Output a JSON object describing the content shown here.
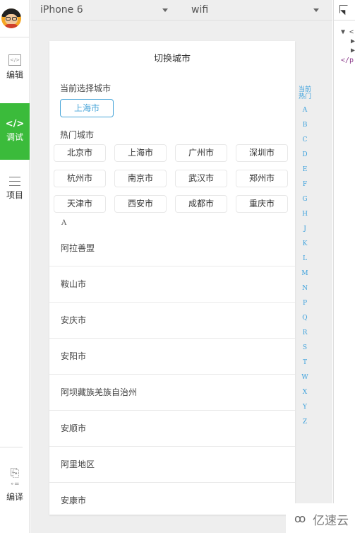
{
  "sidebar": {
    "items": [
      {
        "label": "编辑",
        "icon": "code-editor-icon",
        "icon_text": "</>"
      },
      {
        "label": "调试",
        "icon": "debug-icon",
        "icon_text": "</>",
        "active": true
      },
      {
        "label": "项目",
        "icon": "menu-lines-icon"
      },
      {
        "label": "编译",
        "icon": "compile-icon",
        "icon_text": "⎘",
        "sub_text": "∘="
      }
    ],
    "accent_color": "#3bbb3b"
  },
  "toolbar": {
    "device": "iPhone 6",
    "network": "wifi"
  },
  "phone": {
    "title": "切换城市",
    "current_label": "当前选择城市",
    "current_city": "上海市",
    "hot_label": "热门城市",
    "hot_cities": [
      "北京市",
      "上海市",
      "广州市",
      "深圳市",
      "杭州市",
      "南京市",
      "武汉市",
      "郑州市",
      "天津市",
      "西安市",
      "成都市",
      "重庆市"
    ],
    "group_letter": "A",
    "cities": [
      "阿拉善盟",
      "鞍山市",
      "安庆市",
      "安阳市",
      "阿坝藏族羌族自治州",
      "安顺市",
      "阿里地区",
      "安康市"
    ],
    "index_head": [
      "当前",
      "热门"
    ],
    "index_letters": [
      "A",
      "B",
      "C",
      "D",
      "E",
      "F",
      "G",
      "H",
      "J",
      "K",
      "L",
      "M",
      "N",
      "P",
      "Q",
      "R",
      "S",
      "T",
      "W",
      "X",
      "Y",
      "Z"
    ],
    "link_color": "#3aa0dc"
  },
  "devtools": {
    "lines": [
      "▼ <",
      "▶",
      "▶",
      "</p"
    ]
  },
  "watermark": {
    "logo": "ꝏ",
    "text": "亿速云"
  }
}
